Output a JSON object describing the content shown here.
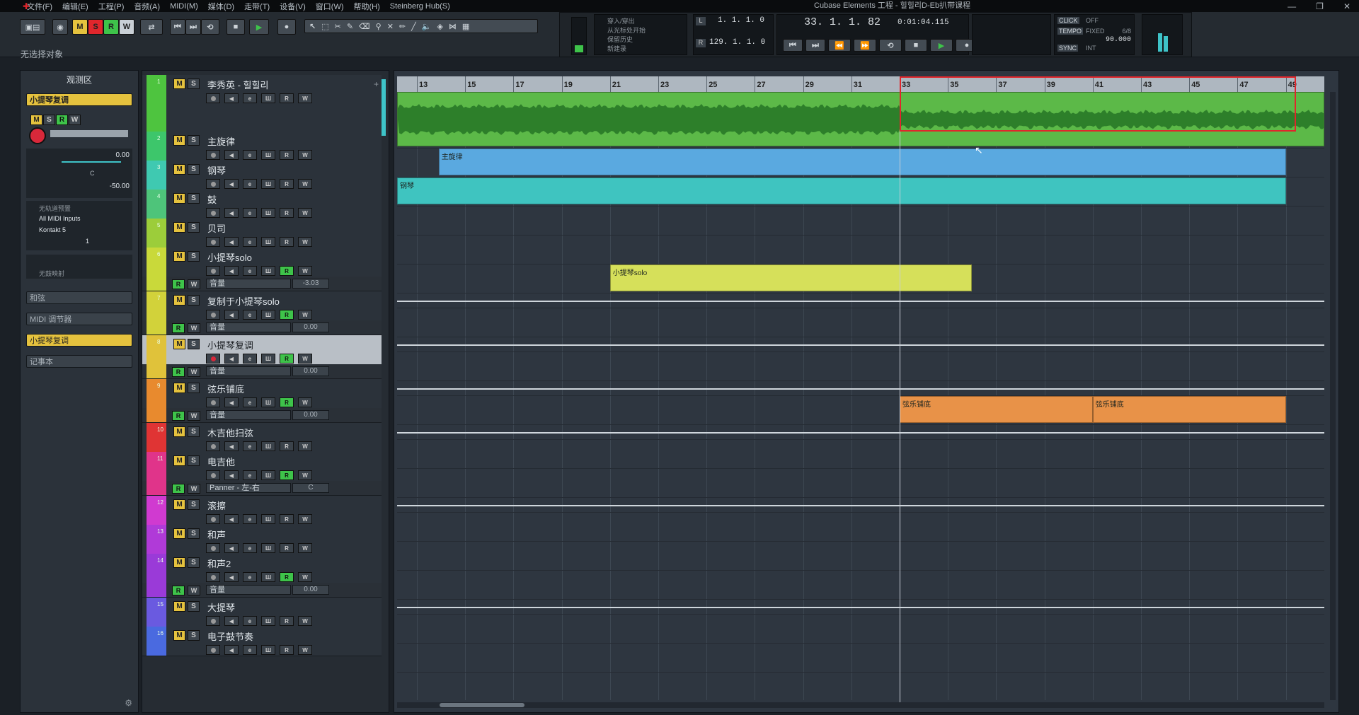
{
  "menu": [
    "文件(F)",
    "编辑(E)",
    "工程(P)",
    "音频(A)",
    "MIDI(M)",
    "媒体(D)",
    "走带(T)",
    "设备(V)",
    "窗口(W)",
    "帮助(H)",
    "Steinberg Hub(S)"
  ],
  "window_title": "Cubase Elements 工程 - 힐힐리D-Eb扒带课程",
  "toolbar": {
    "m": "M",
    "s": "S",
    "r": "R",
    "w": "W"
  },
  "status": "无选择对象",
  "transport": {
    "punch_labels": [
      "穿入/穿出",
      "从光标处开始",
      "保留历史",
      "新建录"
    ],
    "left_locator": "1. 1. 1.   0",
    "right_locator": "129. 1. 1.   0",
    "position": "33.  1.  1.  82",
    "time": "0:01:04.115",
    "click_label": "CLICK",
    "click_value": "OFF",
    "tempo_label": "TEMPO",
    "tempo_mode": "FIXED",
    "signature": "6/8",
    "tempo_value": "90.000",
    "sync_label": "SYNC",
    "sync_value": "INT"
  },
  "inspector": {
    "title": "观测区",
    "track_name": "小提琴复调",
    "volume": "0.00",
    "pan": "C",
    "delay": "-50.00",
    "input_none": "无轨道预置",
    "midi_input": "All MIDI Inputs",
    "output": "Kontakt 5",
    "channel": "1",
    "no_map": "无鼓映射",
    "section_chord": "和弦",
    "section_midi": "MIDI 调节器",
    "section_track": "小提琴复调",
    "section_notes": "记事本"
  },
  "tracks": [
    {
      "num": "1",
      "name": "李秀英 - 힐힐리",
      "color": "#4ec43f",
      "type": "audio"
    },
    {
      "num": "2",
      "name": "主旋律",
      "color": "#3dc66b",
      "type": "midi"
    },
    {
      "num": "3",
      "name": "钢琴",
      "color": "#3fc9b1",
      "type": "midi"
    },
    {
      "num": "4",
      "name": "鼓",
      "color": "#4ec47a",
      "type": "midi"
    },
    {
      "num": "5",
      "name": "贝司",
      "color": "#9ccd3a",
      "type": "midi"
    },
    {
      "num": "6",
      "name": "小提琴solo",
      "color": "#c9d93a",
      "type": "midi",
      "auto": {
        "param": "音量",
        "value": "-3.03"
      }
    },
    {
      "num": "7",
      "name": "复制于小提琴solo",
      "color": "#d2d23a",
      "type": "midi",
      "auto": {
        "param": "音量",
        "value": "0.00"
      }
    },
    {
      "num": "8",
      "name": "小提琴复调",
      "color": "#e0c23a",
      "type": "midi",
      "auto": {
        "param": "音量",
        "value": "0.00"
      }
    },
    {
      "num": "9",
      "name": "弦乐铺底",
      "color": "#e88a2e",
      "type": "midi",
      "auto": {
        "param": "音量",
        "value": "0.00"
      }
    },
    {
      "num": "10",
      "name": "木吉他扫弦",
      "color": "#e03434",
      "type": "midi"
    },
    {
      "num": "11",
      "name": "电吉他",
      "color": "#e0348a",
      "type": "midi",
      "auto": {
        "param": "Panner - 左-右",
        "value": "C"
      }
    },
    {
      "num": "12",
      "name": "滚擦",
      "color": "#d03ad0",
      "type": "midi"
    },
    {
      "num": "13",
      "name": "和声",
      "color": "#b03ad8",
      "type": "midi"
    },
    {
      "num": "14",
      "name": "和声2",
      "color": "#9a3ad8",
      "type": "midi",
      "auto": {
        "param": "音量",
        "value": "0.00"
      }
    },
    {
      "num": "15",
      "name": "大提琴",
      "color": "#6a5ae0",
      "type": "midi"
    },
    {
      "num": "16",
      "name": "电子鼓节奏",
      "color": "#4a6ae0",
      "type": "midi"
    }
  ],
  "ruler": [
    "13",
    "15",
    "17",
    "19",
    "21",
    "23",
    "25",
    "27",
    "29",
    "31",
    "33",
    "35",
    "37",
    "39",
    "41",
    "43",
    "45",
    "47",
    "49"
  ],
  "parts": {
    "melody": "主旋律",
    "piano": "钢琴",
    "violin": "小提琴solo",
    "strings1": "弦乐铺底",
    "strings2": "弦乐铺底"
  }
}
